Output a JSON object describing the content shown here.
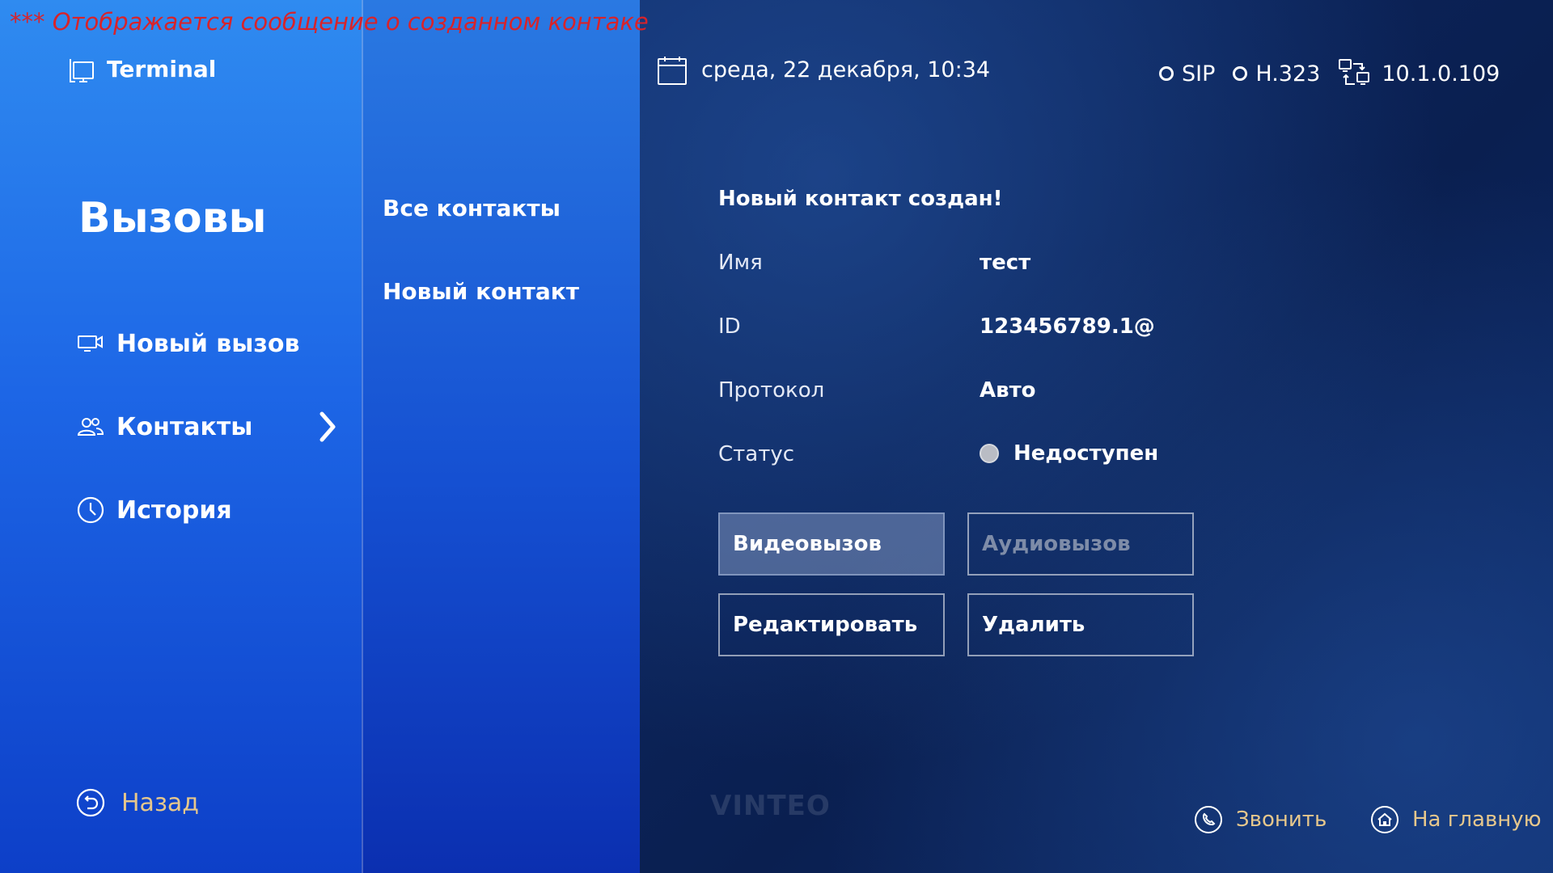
{
  "annotation": "*** Отображается сообщение о созданном контаке",
  "app": {
    "title": "Terminal",
    "icon": "terminal-icon"
  },
  "left_nav": {
    "section_title": "Вызовы",
    "items": [
      {
        "label": "Новый вызов",
        "icon": "video-camera-icon"
      },
      {
        "label": "Контакты",
        "icon": "contacts-icon",
        "active": true
      },
      {
        "label": "История",
        "icon": "clock-icon"
      }
    ],
    "back_label": "Назад"
  },
  "sub_nav": {
    "items": [
      {
        "label": "Все контакты"
      },
      {
        "label": "Новый контакт"
      }
    ]
  },
  "header": {
    "datetime": "среда, 22 декабря, 10:34",
    "protocols": [
      "SIP",
      "H.323"
    ],
    "ip": "10.1.0.109"
  },
  "contact": {
    "message": "Новый контакт создан!",
    "fields": {
      "name": {
        "label": "Имя",
        "value": "тест"
      },
      "id": {
        "label": "ID",
        "value": "123456789.1@"
      },
      "protocol": {
        "label": "Протокол",
        "value": "Авто"
      },
      "status": {
        "label": "Статус",
        "value": "Недоступен"
      }
    }
  },
  "buttons": {
    "video_call": "Видеовызов",
    "audio_call": "Аудиовызов",
    "edit": "Редактировать",
    "delete": "Удалить"
  },
  "footer": {
    "logo": "VINTEO",
    "call_label": "Звонить",
    "home_label": "На главную"
  },
  "colors": {
    "accent_gold": "#e6c78c",
    "annotation_red": "#d8232a",
    "status_offline": "#b9bcc4"
  }
}
